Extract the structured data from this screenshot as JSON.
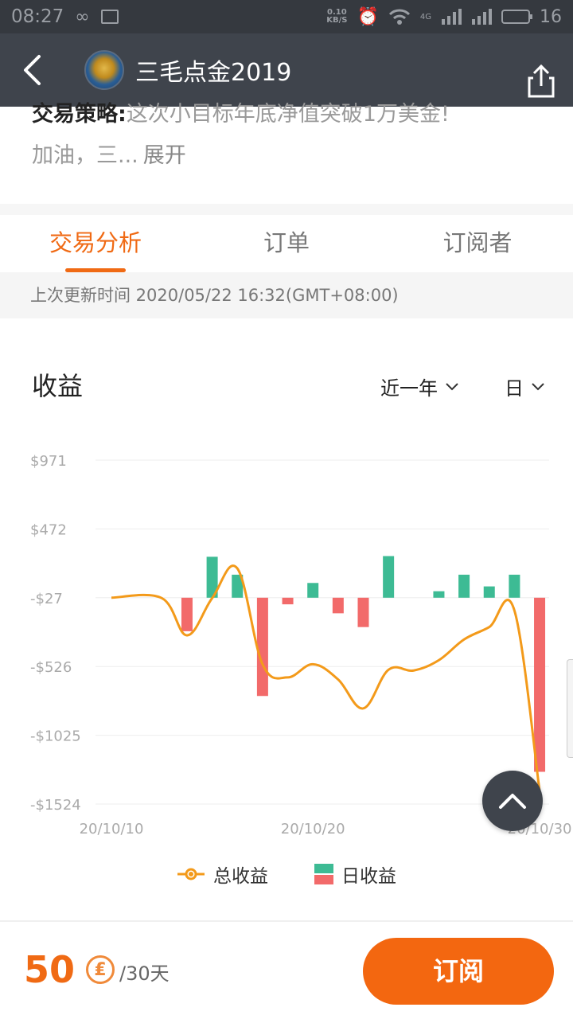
{
  "status_bar": {
    "time": "08:27",
    "speed": "0.10",
    "speed_unit": "KB/S",
    "network": "4G",
    "battery": "16"
  },
  "nav": {
    "title": "三毛点金2019",
    "icons": [
      "back-chevron-icon",
      "avatar-image",
      "share-icon"
    ]
  },
  "strategy": {
    "label": "交易策略:",
    "text": "这次小目标年底净值突破1万美金!",
    "line2": "加油，三...",
    "expand": "展开"
  },
  "tabs": [
    {
      "label": "交易分析",
      "active": true
    },
    {
      "label": "订单",
      "active": false
    },
    {
      "label": "订阅者",
      "active": false
    }
  ],
  "update_text": "上次更新时间 2020/05/22 16:32(GMT+08:00)",
  "chart_header": {
    "title": "收益",
    "range_select": "近一年",
    "unit_select": "日"
  },
  "colors": {
    "accent": "#f06a14",
    "line": "#f39a1a",
    "bar_positive": "#3dbb94",
    "bar_negative": "#f26a6a",
    "nav_bg": "#3f444c"
  },
  "chart_data": {
    "type": "bar",
    "ylim": [
      -1524,
      971
    ],
    "y_ticks": [
      "$971",
      "$472",
      "-$27",
      "-$526",
      "-$1025",
      "-$1524"
    ],
    "y_tick_values": [
      971,
      472,
      -27,
      -526,
      -1025,
      -1524
    ],
    "x_ticks": [
      "20/10/10",
      "20/10/20",
      "20/10/30"
    ],
    "x_tick_index": [
      0,
      8,
      17
    ],
    "x_index_range": [
      0,
      17
    ],
    "series": [
      {
        "name": "日收益",
        "type": "bar",
        "points": [
          {
            "x": 3,
            "y": -270
          },
          {
            "x": 4,
            "y": 270
          },
          {
            "x": 5,
            "y": 140
          },
          {
            "x": 6,
            "y": -740
          },
          {
            "x": 7,
            "y": -75
          },
          {
            "x": 8,
            "y": 80
          },
          {
            "x": 9,
            "y": -140
          },
          {
            "x": 10,
            "y": -240
          },
          {
            "x": 11,
            "y": 275
          },
          {
            "x": 13,
            "y": 20
          },
          {
            "x": 14,
            "y": 140
          },
          {
            "x": 15,
            "y": 55
          },
          {
            "x": 16,
            "y": 140
          },
          {
            "x": 17,
            "y": -1290
          }
        ]
      },
      {
        "name": "总收益",
        "type": "line",
        "points": [
          {
            "x": 0,
            "y": -27
          },
          {
            "x": 2,
            "y": -30
          },
          {
            "x": 3,
            "y": -300
          },
          {
            "x": 4,
            "y": -30
          },
          {
            "x": 5,
            "y": 185
          },
          {
            "x": 6,
            "y": -510
          },
          {
            "x": 7,
            "y": -605
          },
          {
            "x": 8,
            "y": -510
          },
          {
            "x": 9,
            "y": -620
          },
          {
            "x": 10,
            "y": -830
          },
          {
            "x": 11,
            "y": -550
          },
          {
            "x": 12,
            "y": -555
          },
          {
            "x": 13,
            "y": -480
          },
          {
            "x": 14,
            "y": -330
          },
          {
            "x": 15,
            "y": -240
          },
          {
            "x": 16,
            "y": -120
          },
          {
            "x": 17,
            "y": -1430
          }
        ]
      }
    ],
    "legend": [
      "总收益",
      "日收益"
    ],
    "grid": true,
    "legend_position": "bottom"
  },
  "bottom_bar": {
    "price": "50",
    "coin_symbol": "₤",
    "period": "/30天",
    "subscribe_label": "订阅"
  }
}
